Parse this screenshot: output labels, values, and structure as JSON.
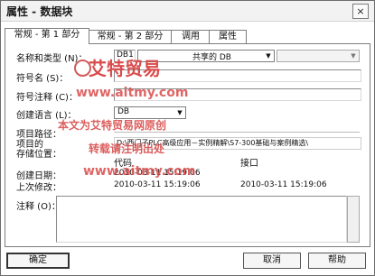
{
  "window": {
    "title": "属性 - 数据块",
    "close_glyph": "×"
  },
  "tabs": [
    {
      "label": "常规 - 第 1 部分"
    },
    {
      "label": "常规 - 第 2 部分"
    },
    {
      "label": "调用"
    },
    {
      "label": "属性"
    }
  ],
  "form": {
    "name_type_label": "名称和类型 (N)：",
    "name_value": "DB1",
    "type_value": "共享的 DB",
    "symbol_name_label": "符号名 (S)：",
    "symbol_comment_label": "符号注释 (C)：",
    "language_label": "创建语言 (L)：",
    "language_value": "DB",
    "project_path_label": "项目路径：",
    "storage_location_label_1": "项目的",
    "storage_location_label_2": "存储位置：",
    "storage_location_value": "D:\\西门子PLC高级应用－实例精解\\S7-300基础与案例精选\\",
    "col_code": "代码",
    "col_interface": "接口",
    "created_label": "创建日期：",
    "created_code": "2010-03-11 15:19:06",
    "modified_label": "上次修改：",
    "modified_code": "2010-03-11 15:19:06",
    "modified_interface": "2010-03-11 15:19:06",
    "comment_label": "注释 (O)："
  },
  "buttons": {
    "ok": "确定",
    "cancel": "取消",
    "help": "帮助"
  },
  "watermark": {
    "brand": "艾特贸易",
    "url": "www.aitmy.com",
    "line3": "本文为艾特贸易网原创",
    "line4": "转载请注明出处",
    "color": "#d94c4c"
  }
}
